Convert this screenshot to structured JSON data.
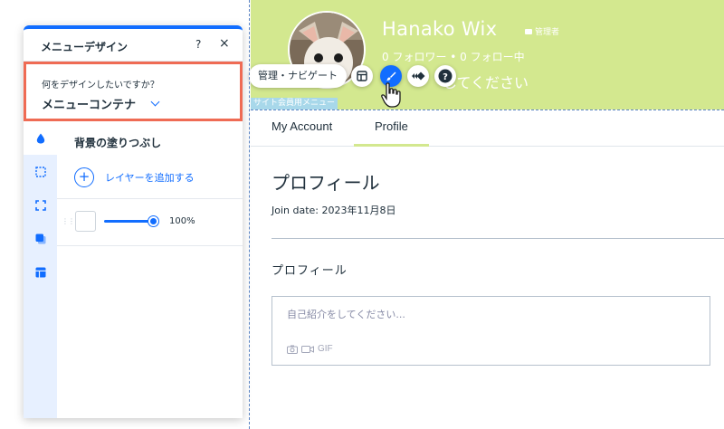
{
  "colors": {
    "accent": "#116dff",
    "cover": "#d3e88f",
    "highlight_border": "#ef6b54",
    "rail_bg": "#e7f0ff",
    "guide": "#5b84c4"
  },
  "site": {
    "profile": {
      "name": "Hanako Wix",
      "admin_badge": "管理者",
      "follow_stats": "0 フォロワー • 0 フォロー中",
      "bio_prompt": "してください",
      "photo_icon": "dog-profile-photo"
    },
    "menu_tag": "サイト会員用メニュー",
    "toolbar": {
      "label": "管理・ナビゲート",
      "buttons": [
        {
          "icon": "layout-icon"
        },
        {
          "icon": "design-brush-icon"
        },
        {
          "icon": "animation-icon"
        },
        {
          "icon": "help-icon"
        }
      ]
    },
    "tabs": [
      {
        "label": "My Account"
      },
      {
        "label": "Profile"
      }
    ],
    "selected_tab": "Profile",
    "section_title": "プロフィール",
    "join_date": "Join date: 2023年11月8日",
    "sub_title": "プロフィール",
    "bio_input": {
      "placeholder": "自己紹介をしてください...",
      "tools": [
        "camera-icon",
        "video-icon",
        "GIF"
      ]
    }
  },
  "panel": {
    "title": "メニューデザイン",
    "help_label": "?",
    "close_label": "×",
    "select": {
      "question": "何をデザインしたいですか？",
      "value": "メニューコンテナ"
    },
    "rail": [
      {
        "icon": "fill-drop-icon",
        "active": true
      },
      {
        "icon": "border-icon"
      },
      {
        "icon": "corners-icon"
      },
      {
        "icon": "shadow-icon"
      },
      {
        "icon": "layout-icon"
      }
    ],
    "fill": {
      "title": "背景の塗りつぶし",
      "add_layer": "レイヤーを追加する",
      "add_icon": "+",
      "layer": {
        "swatch_color": "#ffffff",
        "opacity_value": 100,
        "opacity_text": "100%"
      }
    }
  }
}
